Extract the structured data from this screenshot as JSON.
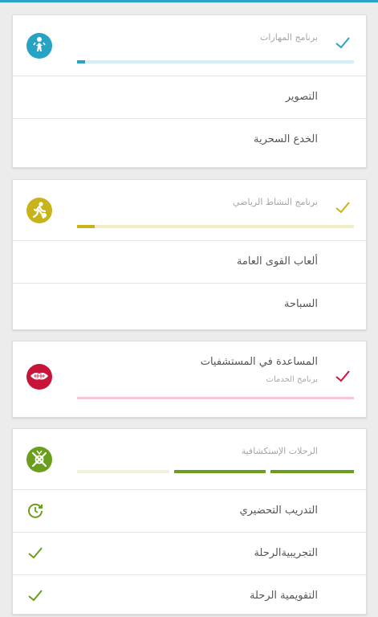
{
  "colors": {
    "accent": "#27a3c4",
    "yellow": "#c8b31a",
    "red": "#c9143a",
    "green": "#6a9e1c",
    "pink": "#f6c6d3",
    "lightblue": "#d3eef6",
    "lightyellow": "#f2edc6",
    "lightgreen": "#eef2df"
  },
  "cards": [
    {
      "title": "برنامج المهارات",
      "icon": "child-figure-icon",
      "check": "check-icon",
      "progress": 0.03,
      "items": [
        {
          "label": "التصوير"
        },
        {
          "label": "الخدع السحرية"
        }
      ]
    },
    {
      "title": "برنامج النشاط الرياضي",
      "icon": "runner-icon",
      "check": "check-icon",
      "progress": 0.06,
      "items": [
        {
          "label": "ألعاب القوى العامة"
        },
        {
          "label": "السباحة"
        }
      ]
    },
    {
      "title": "المساعدة في المستشفيات",
      "subtitle": "برنامج الخدمات",
      "icon": "helping-hands-icon",
      "check": "check-icon",
      "progress": 0
    },
    {
      "title": "الرحلات الإستكشافية",
      "icon": "compass-icon",
      "segments": [
        0,
        1,
        1
      ],
      "items": [
        {
          "label": "التدريب التحضيري",
          "icon": "clock-icon"
        },
        {
          "label": "التجريبيةالرحلة",
          "icon": "check-icon"
        },
        {
          "label": "التقويمية الرحلة",
          "icon": "check-icon"
        }
      ]
    }
  ]
}
